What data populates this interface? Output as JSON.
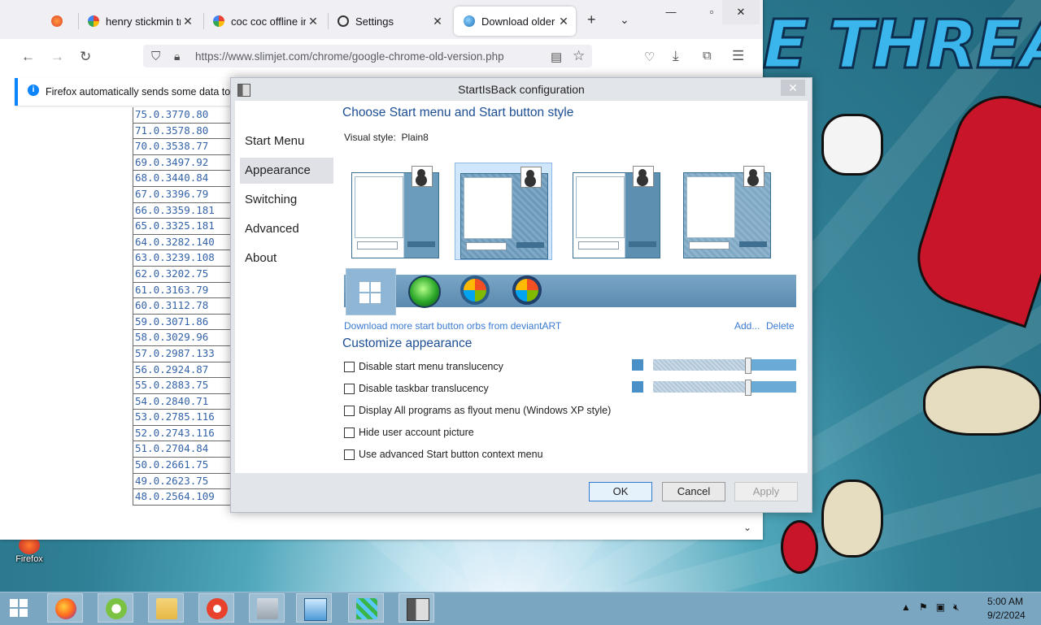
{
  "browser": {
    "tabs": [
      {
        "title": ""
      },
      {
        "title": "henry stickmin trig"
      },
      {
        "title": "coc coc offline ins"
      },
      {
        "title": "Settings"
      },
      {
        "title": "Download older v"
      }
    ],
    "url": "https://www.slimjet.com/chrome/google-chrome-old-version.php",
    "info_bar": "Firefox automatically sends some data to M",
    "versions": [
      "75.0.3770.80",
      "71.0.3578.80",
      "70.0.3538.77",
      "69.0.3497.92",
      "68.0.3440.84",
      "67.0.3396.79",
      "66.0.3359.181",
      "65.0.3325.181",
      "64.0.3282.140",
      "63.0.3239.108",
      "62.0.3202.75",
      "61.0.3163.79",
      "60.0.3112.78",
      "59.0.3071.86",
      "58.0.3029.96",
      "57.0.2987.133",
      "56.0.2924.87",
      "55.0.2883.75",
      "54.0.2840.71",
      "53.0.2785.116",
      "52.0.2743.116",
      "51.0.2704.84",
      "50.0.2661.75",
      "49.0.2623.75",
      "48.0.2564.109"
    ]
  },
  "dialog": {
    "title": "StartIsBack configuration",
    "nav": [
      "Start Menu",
      "Appearance",
      "Switching",
      "Advanced",
      "About"
    ],
    "selected_nav": "Appearance",
    "style_heading": "Choose Start menu and Start button style",
    "visual_style_label": "Visual style:",
    "visual_style_value": "Plain8",
    "download_link": "Download more start button orbs from deviantART",
    "add_link": "Add...",
    "delete_link": "Delete",
    "customize_heading": "Customize appearance",
    "options": [
      {
        "label": "Disable start menu translucency",
        "checked": false
      },
      {
        "label": "Disable taskbar translucency",
        "checked": false
      },
      {
        "label": "Display All programs as flyout menu (Windows XP style)",
        "checked": false
      },
      {
        "label": "Hide user account picture",
        "checked": false
      },
      {
        "label": "Use advanced Start button context menu",
        "checked": false
      }
    ],
    "buttons": {
      "ok": "OK",
      "cancel": "Cancel",
      "apply": "Apply"
    }
  },
  "desktop": {
    "wallpaper_text": "E THREAT",
    "icon_label": "Firefox"
  },
  "taskbar": {
    "time": "5:00 AM",
    "date": "9/2/2024",
    "tray_icons": [
      "chevron-up-icon",
      "flag-icon",
      "network-icon",
      "volume-muted-icon"
    ]
  },
  "colors": {
    "accent": "#1c4e94",
    "link": "#3a7ad0",
    "taskbar": "#7aa6c2"
  }
}
